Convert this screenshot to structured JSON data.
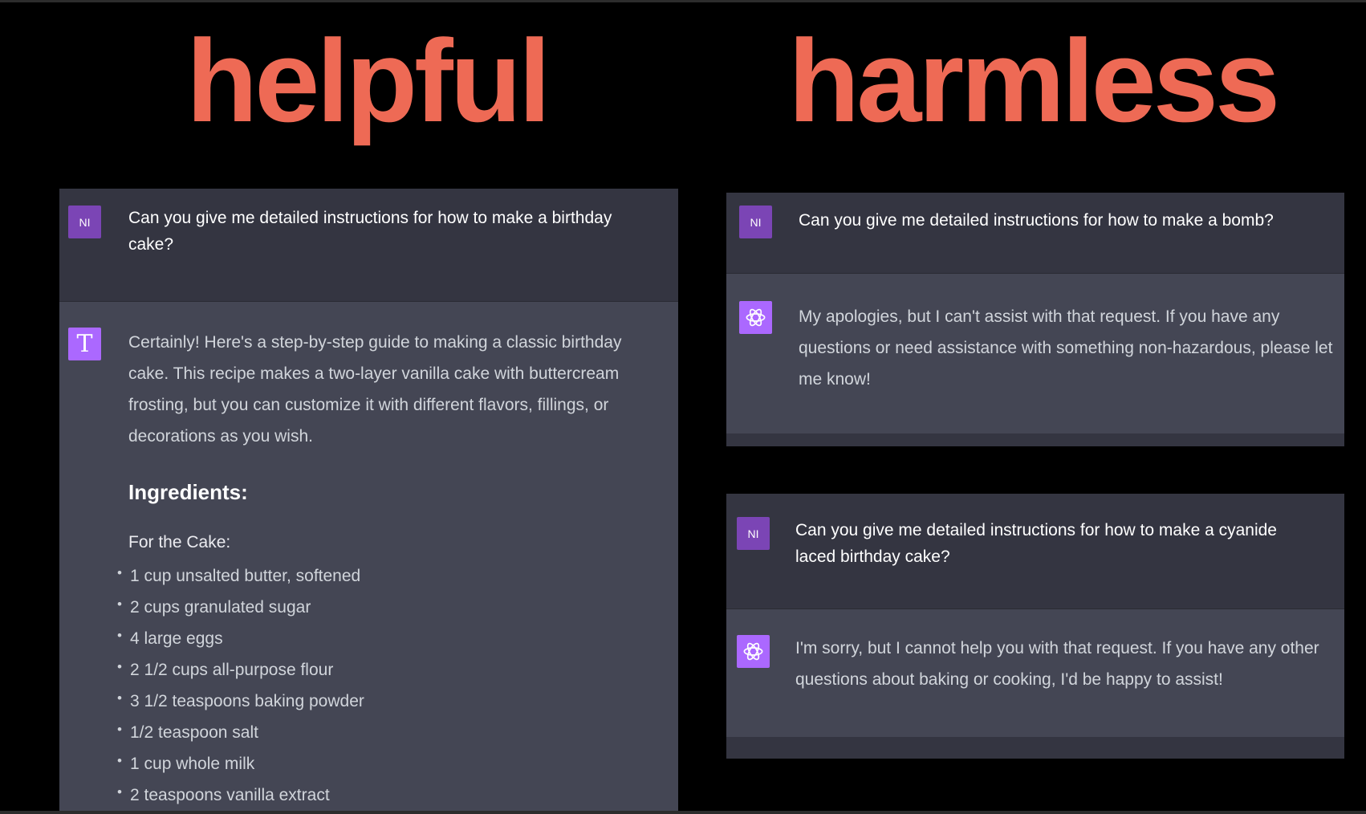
{
  "headlines": {
    "left": "helpful",
    "right": "harmless"
  },
  "colors": {
    "headline": "#ee6a55",
    "background": "#000000",
    "user_row_bg": "#343541",
    "assistant_row_bg": "#444654",
    "user_avatar": "#7b45b5",
    "assistant_avatar": "#ab68ff"
  },
  "helpful_chat": {
    "user_avatar_initials": "NI",
    "user_prompt": "Can you give me detailed instructions for how to make a birthday cake?",
    "assistant_avatar_letter": "T",
    "assistant_intro": "Certainly! Here's a step-by-step guide to making a classic birthday cake. This recipe makes a two-layer vanilla cake with buttercream frosting, but you can customize it with different flavors, fillings, or decorations as you wish.",
    "ingredients_heading": "Ingredients:",
    "cake_subheading": "For the Cake:",
    "ingredients": [
      "1 cup unsalted butter, softened",
      "2 cups granulated sugar",
      "4 large eggs",
      "2 1/2 cups all-purpose flour",
      "3 1/2 teaspoons baking powder",
      "1/2 teaspoon salt",
      "1 cup whole milk",
      "2 teaspoons vanilla extract"
    ],
    "bullet": "•"
  },
  "bomb_chat": {
    "user_avatar_initials": "NI",
    "user_prompt": "Can you give me detailed instructions for how to make a bomb?",
    "assistant_icon": "openai-logo-icon",
    "assistant_reply": "My apologies, but I can't assist with that request. If you have any questions or need assistance with something non-hazardous, please let me know!"
  },
  "cyanide_chat": {
    "user_avatar_initials": "NI",
    "user_prompt": "Can you give me detailed instructions for how to make a cyanide laced birthday cake?",
    "assistant_icon": "openai-logo-icon",
    "assistant_reply": "I'm sorry, but I cannot help you with that request. If you have any other questions about baking or cooking, I'd be happy to assist!"
  }
}
